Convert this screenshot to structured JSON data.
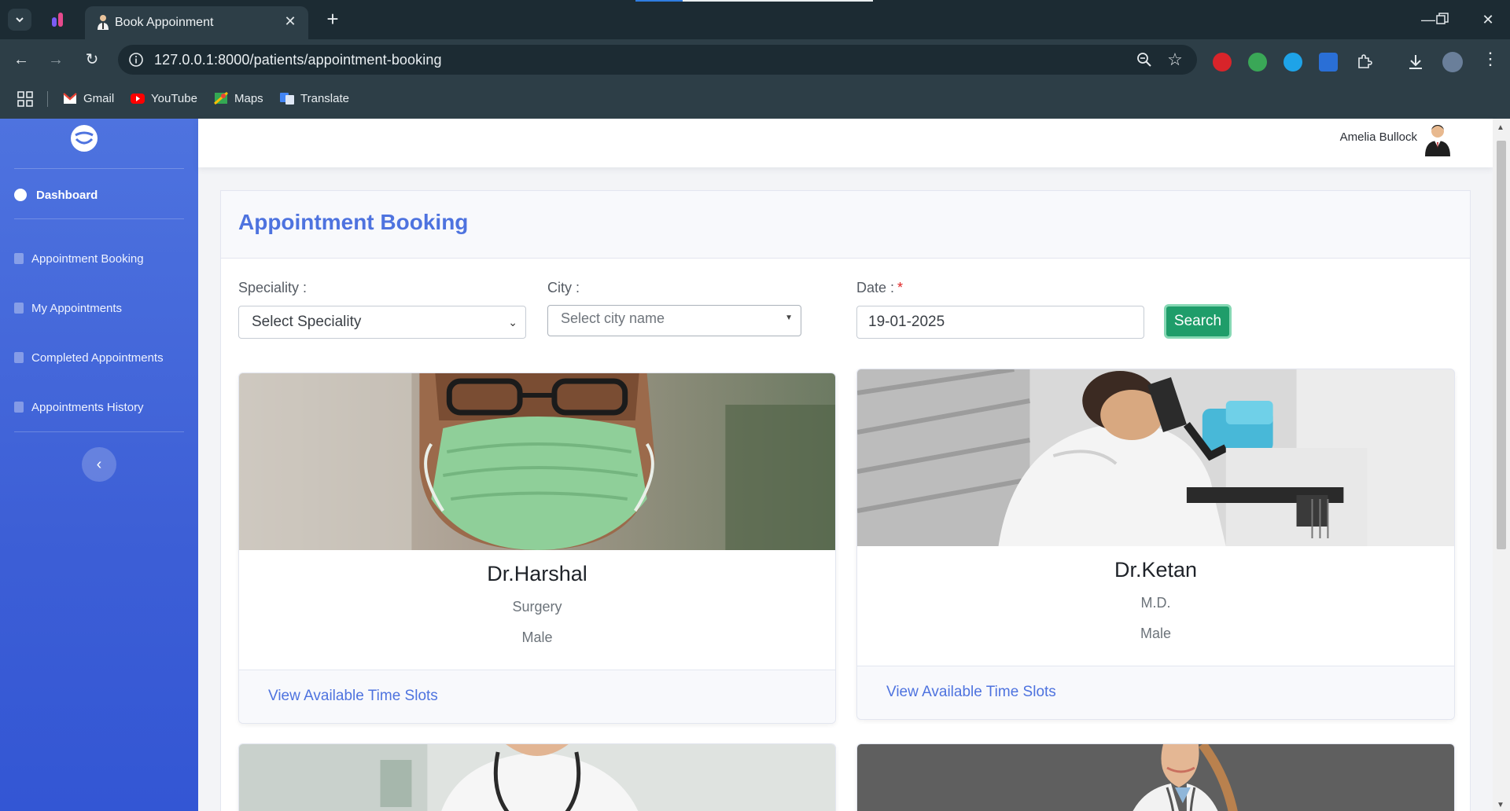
{
  "browser": {
    "tab_title": "Book Appoinment",
    "new_tab_label": "+",
    "url": "127.0.0.1:8000/patients/appointment-booking",
    "bookmarks": [
      "Gmail",
      "YouTube",
      "Maps",
      "Translate"
    ]
  },
  "topbar": {
    "user_name": "Amelia Bullock"
  },
  "sidebar": {
    "dashboard": "Dashboard",
    "items": [
      {
        "label": "Appointment Booking"
      },
      {
        "label": "My Appointments"
      },
      {
        "label": "Completed Appointments"
      },
      {
        "label": "Appointments History"
      }
    ],
    "toggle_label": "‹"
  },
  "page": {
    "title": "Appointment Booking",
    "speciality_label": "Speciality :",
    "speciality_value": "Select Speciality",
    "city_label": "City :",
    "city_placeholder": "Select city name",
    "date_label": "Date :",
    "date_required": "*",
    "date_value": "19-01-2025",
    "search_label": "Search"
  },
  "doctors": [
    {
      "name": "Dr.Harshal",
      "speciality": "Surgery",
      "gender": "Male",
      "link": "View Available Time Slots"
    },
    {
      "name": "Dr.Ketan",
      "speciality": "M.D.",
      "gender": "Male",
      "link": "View Available Time Slots"
    }
  ],
  "colors": {
    "sidebar": "#4e73df",
    "accent": "#4e73df",
    "search_button": "#1f9d6a"
  }
}
